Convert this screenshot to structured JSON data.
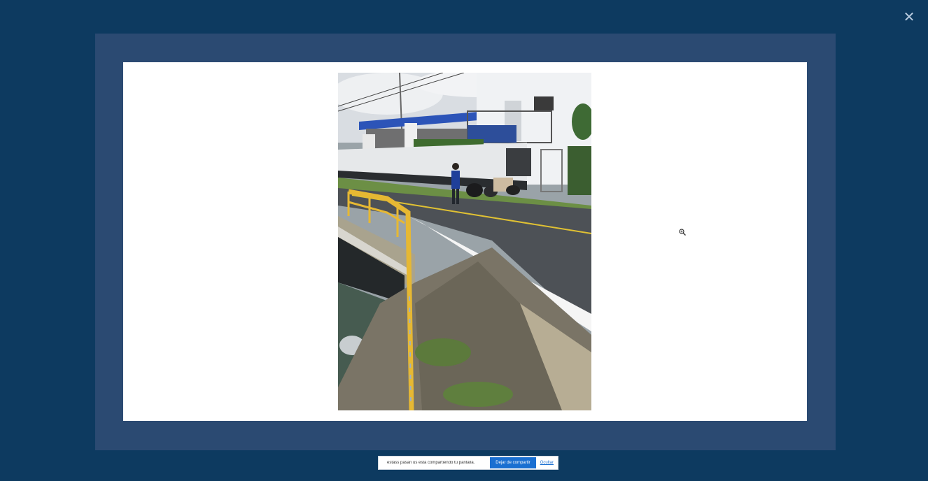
{
  "viewer": {
    "close_icon_glyph": "✕"
  },
  "photo": {
    "description_icon": "photo-image",
    "zoom_cursor_icon": "zoom-in-icon"
  },
  "share_bar": {
    "message": "estáss pasan us está compartiendo tu pantalla.",
    "stop_label": "Dejar de compartir",
    "hide_label": "Ocultar"
  },
  "colors": {
    "backdrop": "#0d3a60",
    "frame": "#2b4a72",
    "canvas": "#ffffff",
    "accent": "#1a6fd1"
  }
}
